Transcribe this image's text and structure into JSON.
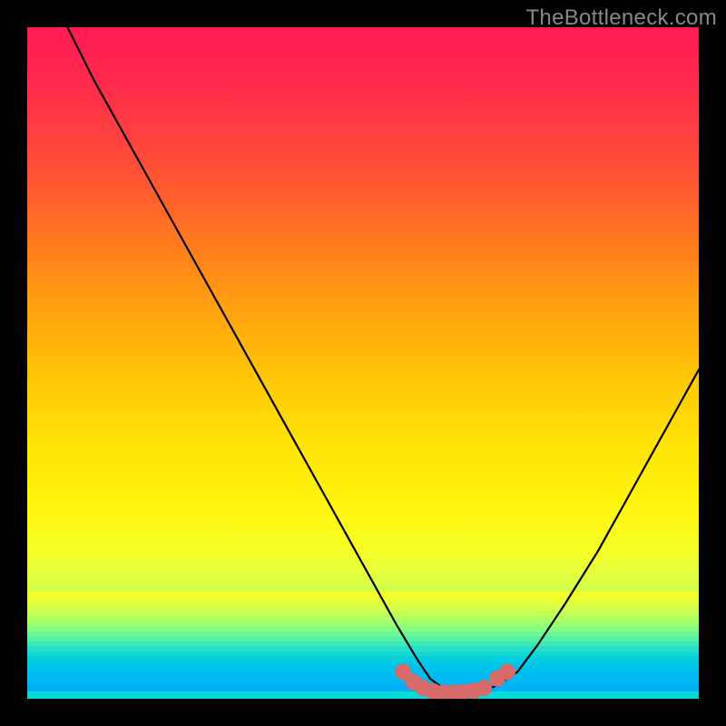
{
  "watermark": "TheBottleneck.com",
  "chart_data": {
    "type": "line",
    "title": "",
    "xlabel": "",
    "ylabel": "",
    "xlim": [
      0,
      100
    ],
    "ylim": [
      0,
      100
    ],
    "series": [
      {
        "name": "bottleneck-curve",
        "x": [
          6,
          10,
          15,
          20,
          25,
          30,
          35,
          40,
          45,
          50,
          55,
          58,
          60,
          62,
          64,
          66,
          68,
          70,
          73,
          76,
          80,
          85,
          90,
          95,
          100
        ],
        "values": [
          100,
          92,
          83,
          74,
          65,
          56,
          47,
          38,
          29,
          20,
          11,
          6,
          3,
          1.5,
          1,
          1,
          1.2,
          2,
          4,
          8,
          14,
          22,
          31,
          40,
          49
        ]
      }
    ],
    "markers": {
      "name": "bottom-dots",
      "x": [
        56,
        57.5,
        59,
        60.5,
        62,
        63.5,
        65,
        66.5,
        68,
        70,
        71.5
      ],
      "values": [
        4,
        2.5,
        1.6,
        1.1,
        0.9,
        0.9,
        1.0,
        1.2,
        1.6,
        3.0,
        4.0
      ],
      "color": "#d86a6a",
      "radius": 9
    },
    "background": {
      "type": "vertical-gradient",
      "stops": [
        {
          "pos": 0,
          "color": "#ff1a54"
        },
        {
          "pos": 50,
          "color": "#ffd600"
        },
        {
          "pos": 80,
          "color": "#f3ff2a"
        },
        {
          "pos": 100,
          "color": "#00d8dc"
        }
      ]
    }
  }
}
